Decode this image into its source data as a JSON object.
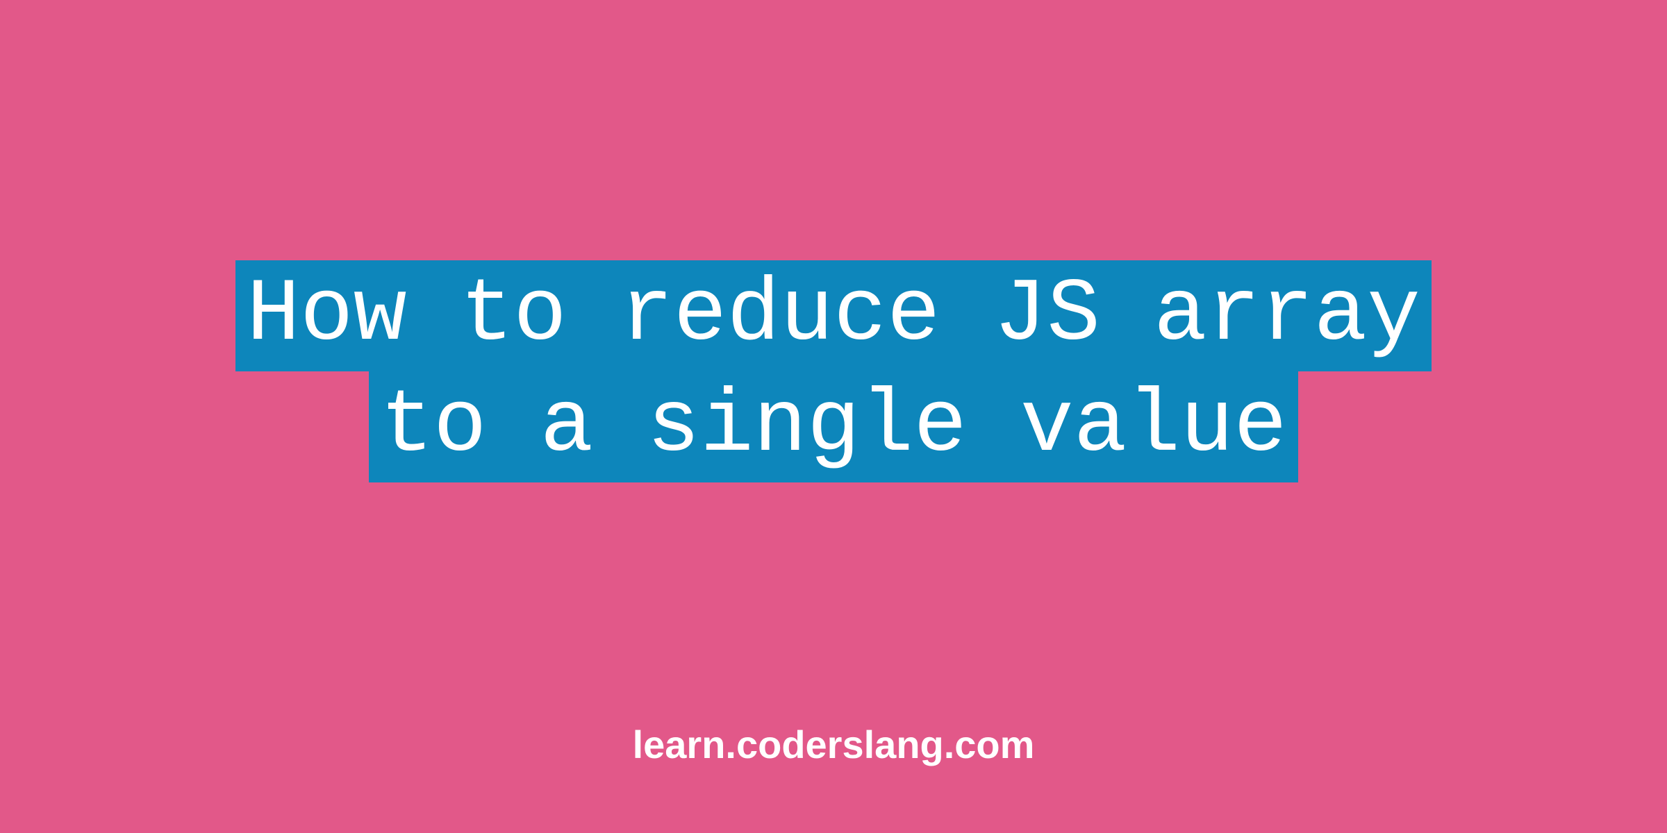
{
  "title": {
    "line1": "How to reduce JS array",
    "line2": "to a single value"
  },
  "footer": {
    "text": "learn.coderslang.com"
  },
  "colors": {
    "background": "#e25889",
    "titleBackground": "#0d86bb",
    "text": "#ffffff"
  }
}
